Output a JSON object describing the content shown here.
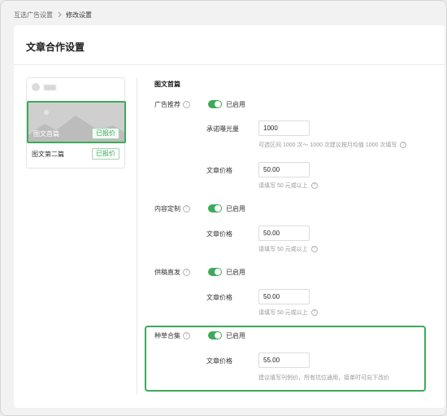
{
  "breadcrumb": {
    "parent": "互选广告设置",
    "current": "修改设置"
  },
  "page": {
    "title": "文章合作设置"
  },
  "articles": {
    "items": [
      {
        "title": "图文首篇",
        "status": "已报价",
        "selected": true
      },
      {
        "title": "图文第二篇",
        "status": "已报价",
        "selected": false
      }
    ]
  },
  "settings": {
    "section_title": "图文首篇",
    "ad_recommend": {
      "label": "广告推荐",
      "toggle_text": "已启用",
      "exposure_label": "承诺曝光量",
      "exposure_value": "1000",
      "exposure_hint": "可选区间 1000 次～ 1000 次建议按月均值 1000 次填写",
      "price_label": "文章价格",
      "price_value": "50.00",
      "price_hint": "请填写 50 元或以上"
    },
    "custom_content": {
      "label": "内容定制",
      "toggle_text": "已启用",
      "price_label": "文章价格",
      "price_value": "50.00",
      "price_hint": "请填写 50 元或以上"
    },
    "submission": {
      "label": "供稿直发",
      "toggle_text": "已启用",
      "price_label": "文章价格",
      "price_value": "50.00",
      "price_hint": "请填写 50 元或以上"
    },
    "collection": {
      "label": "种草合集",
      "toggle_text": "已启用",
      "price_label": "文章价格",
      "price_value": "55.00",
      "price_hint": "建议填写刊例价，所有坑位通用，接单时可向下改价"
    }
  },
  "colors": {
    "accent": "#3daa5a",
    "badge_border": "#9fd5ae",
    "hint_text": "#9a9a9a"
  },
  "icons": {
    "help": "question-circle-icon",
    "breadcrumb_separator": "chevron-right-icon"
  }
}
